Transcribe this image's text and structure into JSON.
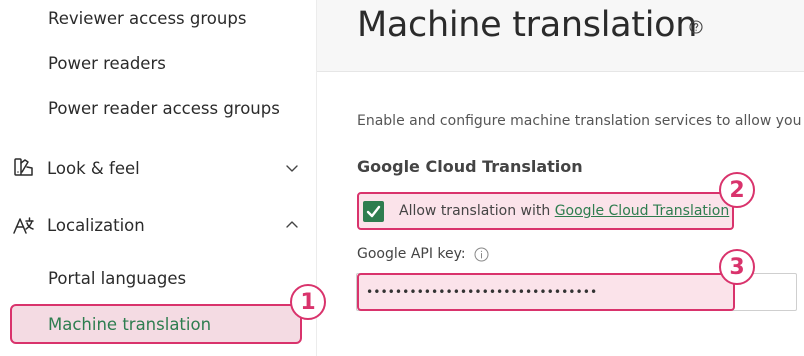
{
  "sidebar": {
    "items": [
      {
        "label": "Reviewer access groups"
      },
      {
        "label": "Power readers"
      },
      {
        "label": "Power reader access groups"
      }
    ],
    "groups": [
      {
        "label": "Look & feel",
        "icon": "look-and-feel-icon",
        "expanded": false
      },
      {
        "label": "Localization",
        "icon": "localization-icon",
        "expanded": true
      }
    ],
    "localization_items": [
      {
        "label": "Portal languages"
      },
      {
        "label": "Machine translation",
        "active": true
      }
    ]
  },
  "header": {
    "title": "Machine translation",
    "help_icon": "question-circle-icon"
  },
  "main": {
    "description": "Enable and configure machine translation services to allow you t",
    "section_title": "Google Cloud Translation",
    "checkbox": {
      "checked": true,
      "label_prefix": "Allow translation with ",
      "label_link": "Google Cloud Translation"
    },
    "api_key": {
      "label": "Google API key:",
      "value": "••••••••••••••••••••••••••••••••"
    }
  },
  "callouts": [
    "1",
    "2",
    "3"
  ],
  "colors": {
    "accent": "#d9336c",
    "highlight_bg": "#fbe3ea",
    "active_nav_bg": "#f4dbe3",
    "green": "#2e7d4f"
  }
}
